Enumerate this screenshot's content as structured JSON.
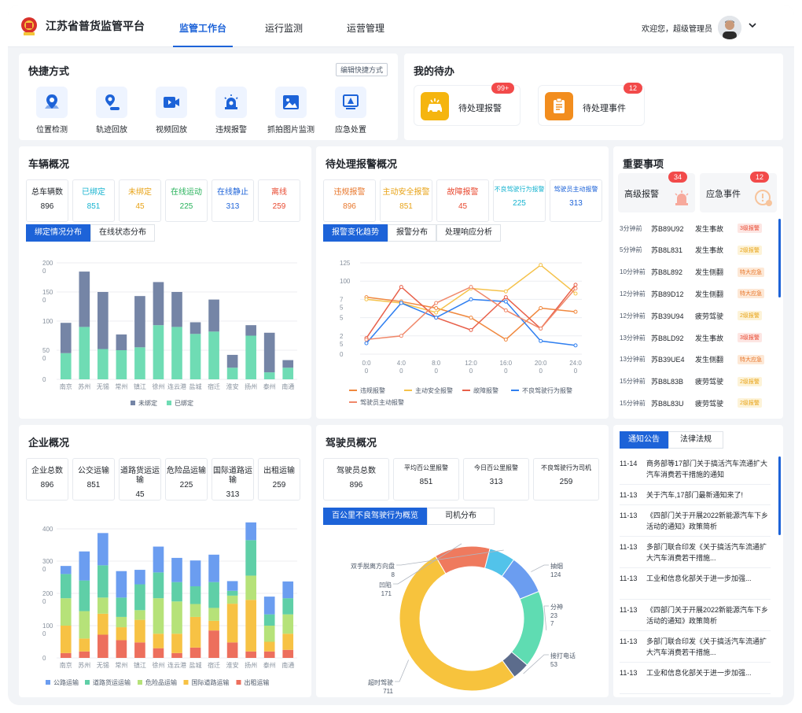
{
  "header": {
    "app_title": "江苏省普货监管平台",
    "nav": [
      "监管工作台",
      "运行监测",
      "运营管理"
    ],
    "welcome": "欢迎您，超级管理员"
  },
  "shortcuts": {
    "title": "快捷方式",
    "edit_label": "编辑快捷方式",
    "items": [
      {
        "label": "位置检测",
        "icon": "location-icon"
      },
      {
        "label": "轨迹回放",
        "icon": "track-icon"
      },
      {
        "label": "视频回放",
        "icon": "video-icon"
      },
      {
        "label": "违规报警",
        "icon": "alarm-light-icon"
      },
      {
        "label": "抓拍图片监测",
        "icon": "image-icon"
      },
      {
        "label": "应急处置",
        "icon": "emergency-icon"
      }
    ]
  },
  "todo": {
    "title": "我的待办",
    "items": [
      {
        "label": "待处理报警",
        "badge": "99+"
      },
      {
        "label": "待处理事件",
        "badge": "12"
      }
    ]
  },
  "vehicle": {
    "title": "车辆概况",
    "stats": [
      {
        "label": "总车辆数",
        "value": "896",
        "color": "#1f2329"
      },
      {
        "label": "已绑定",
        "value": "851",
        "color": "#17b3d0"
      },
      {
        "label": "未绑定",
        "value": "45",
        "color": "#e8a317"
      },
      {
        "label": "在线运动",
        "value": "225",
        "color": "#27b25a"
      },
      {
        "label": "在线静止",
        "value": "313",
        "color": "#1d63d8"
      },
      {
        "label": "离线",
        "value": "259",
        "color": "#e8482f"
      }
    ],
    "tabs": [
      "绑定情况分布",
      "在线状态分布"
    ]
  },
  "alarm": {
    "title": "待处理报警概况",
    "stats": [
      {
        "label": "违规报警",
        "value": "896",
        "color": "#e8772c"
      },
      {
        "label": "主动安全报警",
        "value": "851",
        "color": "#e8a317"
      },
      {
        "label": "故障报警",
        "value": "45",
        "color": "#e8482f"
      },
      {
        "label": "不良驾驶行为报警",
        "value": "225",
        "color": "#17b3d0"
      },
      {
        "label": "驾驶员主动报警",
        "value": "313",
        "color": "#1d63d8"
      }
    ],
    "tabs": [
      "报警变化趋势",
      "报警分布",
      "处理响应分析"
    ]
  },
  "important": {
    "title": "重要事项",
    "boxes": [
      {
        "label": "高级报警",
        "badge": "34"
      },
      {
        "label": "应急事件",
        "badge": "12"
      }
    ],
    "rows": [
      {
        "time": "3分钟前",
        "plate": "苏B89U92",
        "event": "发生事故",
        "level": "3级报警",
        "level_color": "#e8482f",
        "level_bg": "#fde6e3"
      },
      {
        "time": "5分钟前",
        "plate": "苏B8L831",
        "event": "发生事故",
        "level": "2级报警",
        "level_color": "#e8a317",
        "level_bg": "#fdf3d8"
      },
      {
        "time": "10分钟前",
        "plate": "苏B8L892",
        "event": "发生侧翻",
        "level": "特大应急",
        "level_color": "#e8772c",
        "level_bg": "#fde8d6"
      },
      {
        "time": "12分钟前",
        "plate": "苏B89D12",
        "event": "发生侧翻",
        "level": "特大应急",
        "level_color": "#e8772c",
        "level_bg": "#fde8d6"
      },
      {
        "time": "12分钟前",
        "plate": "苏B39U94",
        "event": "疲劳驾驶",
        "level": "2级报警",
        "level_color": "#e8a317",
        "level_bg": "#fdf3d8"
      },
      {
        "time": "13分钟前",
        "plate": "苏B8LD92",
        "event": "发生事故",
        "level": "3级报警",
        "level_color": "#e8482f",
        "level_bg": "#fde6e3"
      },
      {
        "time": "13分钟前",
        "plate": "苏B39UE4",
        "event": "发生侧翻",
        "level": "特大应急",
        "level_color": "#e8772c",
        "level_bg": "#fde8d6"
      },
      {
        "time": "15分钟前",
        "plate": "苏B8L83B",
        "event": "疲劳驾驶",
        "level": "2级报警",
        "level_color": "#e8a317",
        "level_bg": "#fdf3d8"
      },
      {
        "time": "15分钟前",
        "plate": "苏B8L83U",
        "event": "疲劳驾驶",
        "level": "2级报警",
        "level_color": "#e8a317",
        "level_bg": "#fdf3d8"
      }
    ]
  },
  "enterprise": {
    "title": "企业概况",
    "stats": [
      {
        "label": "企业总数",
        "value": "896"
      },
      {
        "label": "公交运输",
        "value": "851"
      },
      {
        "label": "道路货运运输",
        "value": "45"
      },
      {
        "label": "危险品运输",
        "value": "225"
      },
      {
        "label": "国际道路运输",
        "value": "313"
      },
      {
        "label": "出租运输",
        "value": "259"
      }
    ]
  },
  "driver": {
    "title": "驾驶员概况",
    "stats": [
      {
        "label": "驾驶员总数",
        "value": "896"
      },
      {
        "label": "平均百公里报警",
        "value": "851"
      },
      {
        "label": "今日百公里报警",
        "value": "313"
      },
      {
        "label": "不良驾驶行为司机",
        "value": "259"
      }
    ],
    "tabs": [
      "百公里不良驾驶行为概览",
      "司机分布"
    ]
  },
  "notices": {
    "tabs": [
      "通知公告",
      "法律法规"
    ],
    "items": [
      {
        "date": "11-14",
        "text": "商务部等17部门关于搞活汽车流通扩大汽车消费若干措施的通知"
      },
      {
        "date": "11-13",
        "text": "关于汽车,17部门最新通知来了!"
      },
      {
        "date": "11-13",
        "text": "《四部门关于开展2022新能源汽车下乡活动的通知》政策简析"
      },
      {
        "date": "11-13",
        "text": "多部门联合印发《关于搞活汽车流通扩大汽车消费若干措施..."
      },
      {
        "date": "11-13",
        "text": "工业和信息化部关于进一步加强..."
      },
      {
        "date": "11-13",
        "text": "《四部门关于开展2022新能源汽车下乡活动的通知》政策简析"
      },
      {
        "date": "11-13",
        "text": "多部门联合印发《关于搞活汽车流通扩大汽车消费若干措施..."
      },
      {
        "date": "11-13",
        "text": "工业和信息化部关于进一步加强..."
      }
    ]
  },
  "chart_data": [
    {
      "type": "bar",
      "stacked": true,
      "categories": [
        "南京",
        "苏州",
        "无锡",
        "常州",
        "镇江",
        "徐州",
        "连云港",
        "盐城",
        "宿迁",
        "淮安",
        "扬州",
        "泰州",
        "南通"
      ],
      "series": [
        {
          "name": "已绑定",
          "color": "#6fdcb4",
          "values": [
            45,
            90,
            52,
            50,
            55,
            93,
            90,
            78,
            82,
            20,
            75,
            12,
            20
          ]
        },
        {
          "name": "未绑定",
          "color": "#7585a6",
          "values": [
            52,
            95,
            98,
            27,
            88,
            74,
            60,
            20,
            55,
            22,
            18,
            68,
            13
          ]
        }
      ],
      "yticks": [
        "0",
        "50\n0",
        "100",
        "150\n0",
        "200\n0"
      ],
      "ylim": [
        0,
        200
      ]
    },
    {
      "type": "line",
      "categories": [
        "0:0\n0",
        "4:0\n0",
        "8:0\n0",
        "12:0\n0",
        "16:0\n0",
        "20:0\n0",
        "24:0\n0"
      ],
      "yticks": [
        "0",
        "2\n5",
        "5",
        "7\n5",
        "100",
        "125"
      ],
      "ylim": [
        0,
        125
      ],
      "series": [
        {
          "name": "违规报警",
          "color": "#f0883e",
          "values": [
            78,
            72,
            63,
            50,
            20,
            63,
            58
          ]
        },
        {
          "name": "主动安全报警",
          "color": "#f5c24a",
          "values": [
            75,
            70,
            57,
            90,
            86,
            122,
            83
          ]
        },
        {
          "name": "故障报警",
          "color": "#e8604a",
          "values": [
            22,
            92,
            50,
            33,
            78,
            35,
            95
          ]
        },
        {
          "name": "不良驾驶行为报警",
          "color": "#2f7ff0",
          "values": [
            15,
            70,
            50,
            75,
            72,
            18,
            12
          ]
        },
        {
          "name": "驾驶员主动报警",
          "color": "#f0886a",
          "values": [
            20,
            25,
            70,
            92,
            60,
            35,
            90
          ]
        }
      ]
    },
    {
      "type": "bar",
      "stacked": true,
      "categories": [
        "南京",
        "苏州",
        "无锡",
        "常州",
        "镇江",
        "徐州",
        "连云港",
        "盐城",
        "宿迁",
        "淮安",
        "扬州",
        "泰州",
        "南通"
      ],
      "series": [
        {
          "name": "出租运输",
          "color": "#ed6f5d",
          "values": [
            15,
            20,
            72,
            55,
            48,
            30,
            15,
            32,
            85,
            48,
            20,
            20,
            25
          ]
        },
        {
          "name": "国际道路运输",
          "color": "#f7c244",
          "values": [
            85,
            40,
            65,
            40,
            70,
            45,
            60,
            95,
            30,
            120,
            160,
            30,
            50
          ]
        },
        {
          "name": "危险品运输",
          "color": "#b6e279",
          "values": [
            85,
            85,
            50,
            32,
            30,
            110,
            100,
            40,
            40,
            25,
            75,
            50,
            60
          ]
        },
        {
          "name": "道路货运运输",
          "color": "#5fcfa7",
          "values": [
            75,
            95,
            100,
            60,
            80,
            80,
            60,
            55,
            80,
            15,
            110,
            35,
            50
          ]
        },
        {
          "name": "公路运输",
          "color": "#6b9df0",
          "values": [
            25,
            90,
            100,
            82,
            45,
            80,
            75,
            80,
            85,
            30,
            55,
            55,
            52
          ]
        }
      ],
      "yticks": [
        "0",
        "100\n0",
        "200\n0",
        "300\n0",
        "400"
      ],
      "ylim": [
        0,
        400
      ]
    },
    {
      "type": "pie",
      "donut": true,
      "slices": [
        {
          "label": "抽烟",
          "value": "124",
          "color": "#6b9df0",
          "num": 124
        },
        {
          "label": "分神",
          "value": "237",
          "color": "#5fdcb2",
          "num": 237
        },
        {
          "label": "接打电话",
          "value": "53",
          "color": "#5c6c8c",
          "num": 53
        },
        {
          "label": "超时驾驶",
          "value": "711",
          "color": "#f7c33d",
          "num": 711
        },
        {
          "label": "凹陷",
          "value": "171",
          "color": "#ef7a5e",
          "num": 171
        },
        {
          "label": "双手脱离方向盘",
          "value": "8",
          "color": "#52c3ea",
          "num": 80
        }
      ]
    }
  ]
}
